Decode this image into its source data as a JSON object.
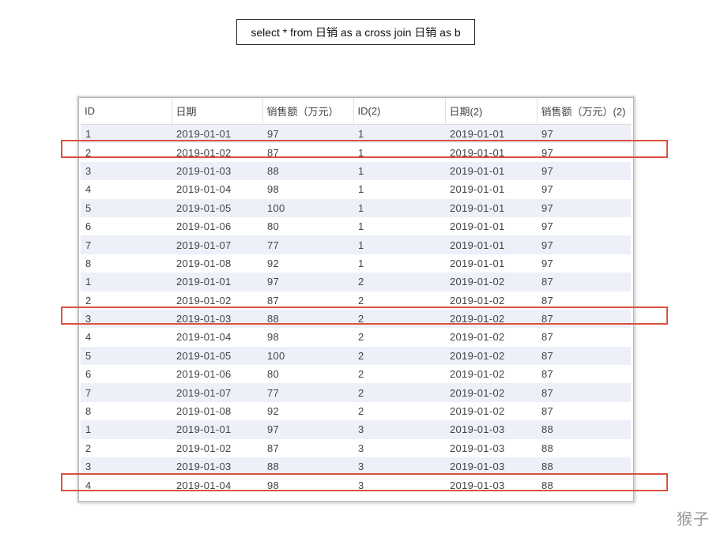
{
  "query": {
    "sql": "select * from 日销 as a cross join 日销 as b"
  },
  "grid": {
    "columns": [
      "ID",
      "日期",
      "销售额（万元）",
      "ID(2)",
      "日期(2)",
      "销售额（万元）(2)"
    ],
    "rows": [
      [
        "1",
        "2019-01-01",
        "97",
        "1",
        "2019-01-01",
        "97"
      ],
      [
        "2",
        "2019-01-02",
        "87",
        "1",
        "2019-01-01",
        "97"
      ],
      [
        "3",
        "2019-01-03",
        "88",
        "1",
        "2019-01-01",
        "97"
      ],
      [
        "4",
        "2019-01-04",
        "98",
        "1",
        "2019-01-01",
        "97"
      ],
      [
        "5",
        "2019-01-05",
        "100",
        "1",
        "2019-01-01",
        "97"
      ],
      [
        "6",
        "2019-01-06",
        "80",
        "1",
        "2019-01-01",
        "97"
      ],
      [
        "7",
        "2019-01-07",
        "77",
        "1",
        "2019-01-01",
        "97"
      ],
      [
        "8",
        "2019-01-08",
        "92",
        "1",
        "2019-01-01",
        "97"
      ],
      [
        "1",
        "2019-01-01",
        "97",
        "2",
        "2019-01-02",
        "87"
      ],
      [
        "2",
        "2019-01-02",
        "87",
        "2",
        "2019-01-02",
        "87"
      ],
      [
        "3",
        "2019-01-03",
        "88",
        "2",
        "2019-01-02",
        "87"
      ],
      [
        "4",
        "2019-01-04",
        "98",
        "2",
        "2019-01-02",
        "87"
      ],
      [
        "5",
        "2019-01-05",
        "100",
        "2",
        "2019-01-02",
        "87"
      ],
      [
        "6",
        "2019-01-06",
        "80",
        "2",
        "2019-01-02",
        "87"
      ],
      [
        "7",
        "2019-01-07",
        "77",
        "2",
        "2019-01-02",
        "87"
      ],
      [
        "8",
        "2019-01-08",
        "92",
        "2",
        "2019-01-02",
        "87"
      ],
      [
        "1",
        "2019-01-01",
        "97",
        "3",
        "2019-01-03",
        "88"
      ],
      [
        "2",
        "2019-01-02",
        "87",
        "3",
        "2019-01-03",
        "88"
      ],
      [
        "3",
        "2019-01-03",
        "88",
        "3",
        "2019-01-03",
        "88"
      ],
      [
        "4",
        "2019-01-04",
        "98",
        "3",
        "2019-01-03",
        "88"
      ]
    ],
    "highlighted_rows": [
      2,
      11,
      20
    ]
  },
  "colors": {
    "highlight": "#d9523f",
    "stripe": "#edf0f9"
  },
  "watermark": "猴子"
}
